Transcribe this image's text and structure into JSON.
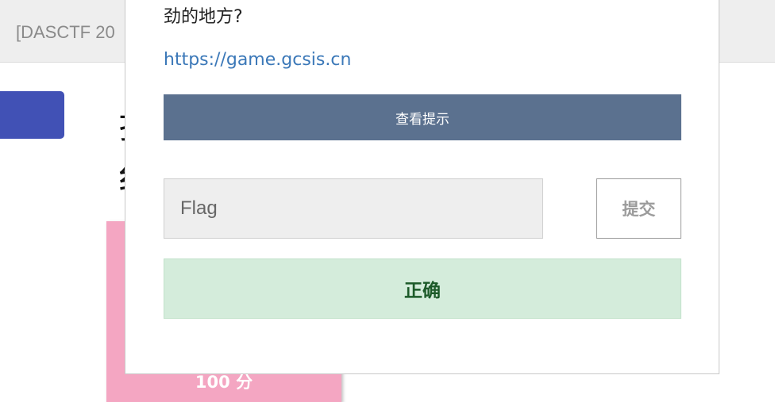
{
  "background": {
    "top_bar_title": "[DASCTF 20",
    "heading_chars": "扌\n纟",
    "card_score": "100 分",
    "colors": {
      "top_bar": "#eeeeee",
      "side_button": "#4151b5",
      "card": "#f4a6c2"
    }
  },
  "modal": {
    "description_tail": "劲的地方?",
    "link": "https://game.gcsis.cn",
    "hint_button_label": "查看提示",
    "flag_input": {
      "placeholder": "Flag",
      "value": ""
    },
    "submit_label": "提交",
    "result_text": "正确",
    "colors": {
      "hint_button": "#5b718f",
      "link": "#3b78b8",
      "result_bg": "#d4ecdb",
      "result_text": "#1c5a29"
    }
  }
}
